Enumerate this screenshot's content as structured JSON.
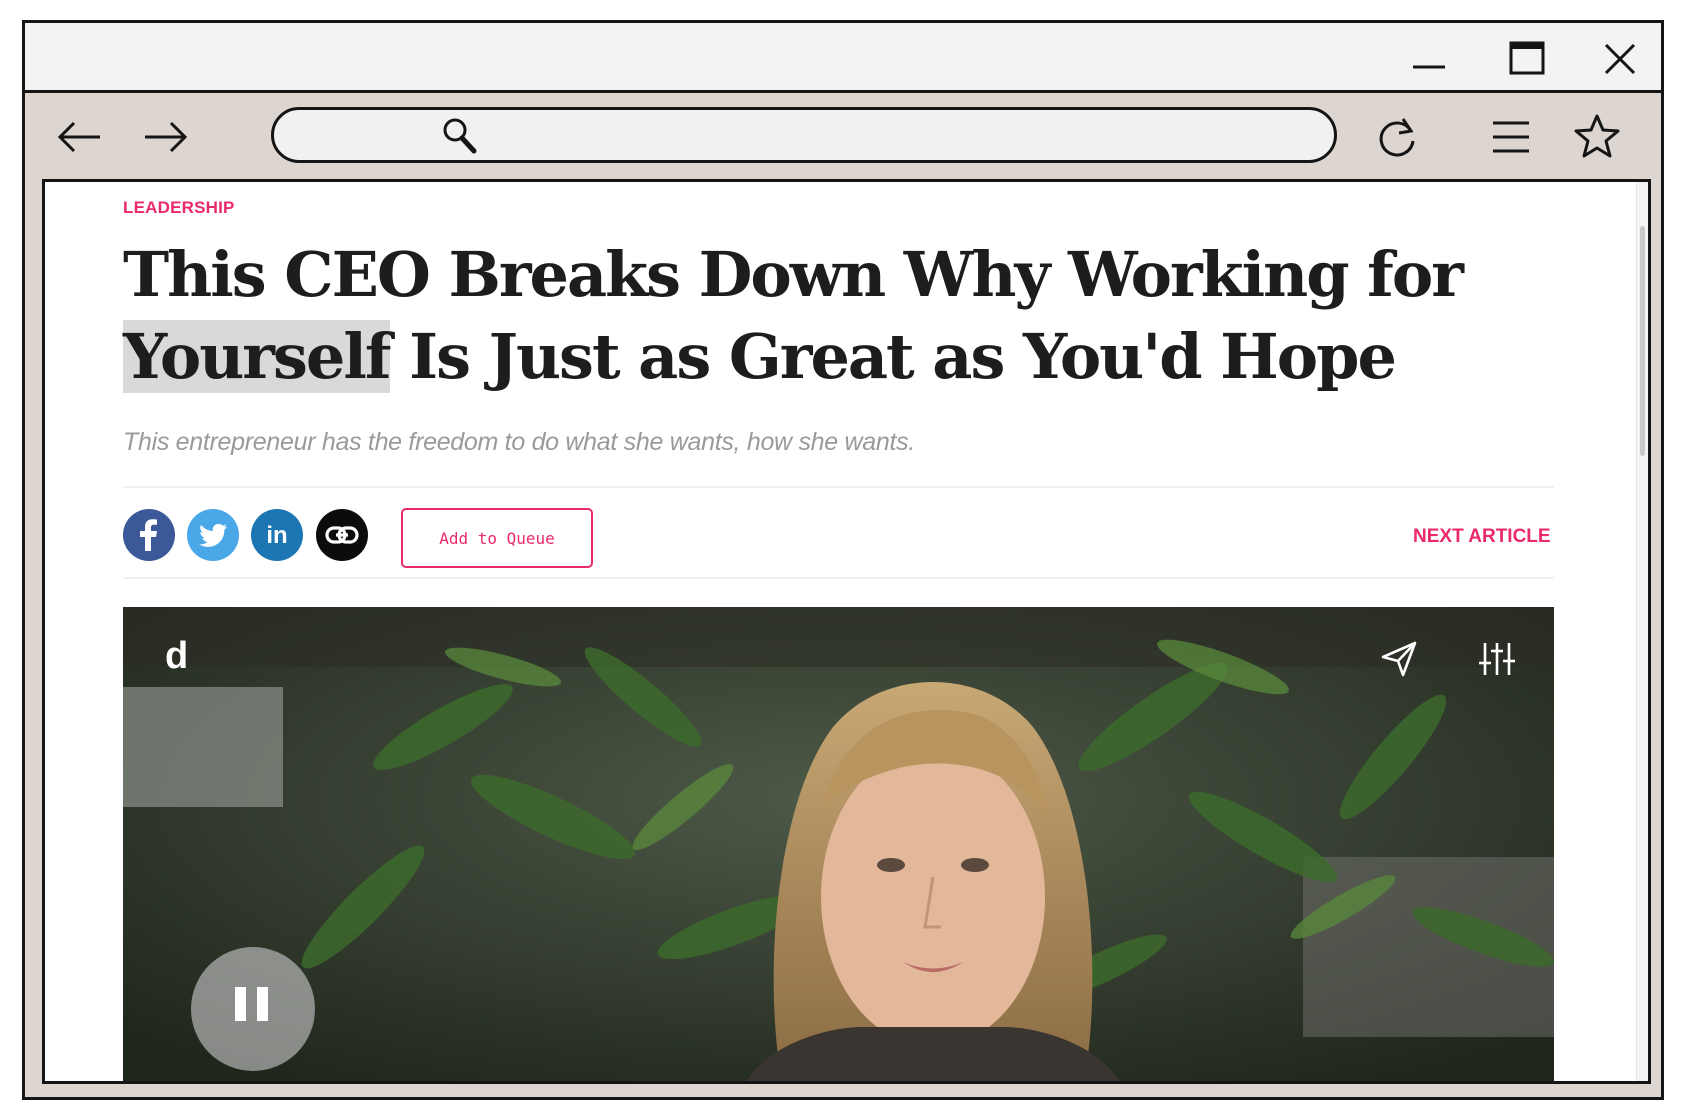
{
  "window": {
    "controls": [
      "minimize-icon",
      "maximize-icon",
      "close-icon"
    ]
  },
  "toolbar": {
    "icons": [
      "arrow-left-icon",
      "arrow-right-icon",
      "search-icon",
      "reload-icon",
      "menu-icon",
      "star-icon"
    ],
    "address_value": ""
  },
  "article": {
    "category": "LEADERSHIP",
    "headline_highlight": "Yourself",
    "headline_pre": "This CEO Breaks Down Why Working for ",
    "headline_post": " Is Just as Great as You'd Hope",
    "dek": "This entrepreneur has the freedom to do what she wants, how she wants.",
    "queue_label": "Add to Queue",
    "next_label": "NEXT ARTICLE"
  },
  "share": {
    "icons": [
      "facebook-icon",
      "twitter-icon",
      "linkedin-icon",
      "link-icon"
    ],
    "linkedin_text": "in"
  },
  "video": {
    "logo": "d",
    "controls": [
      "send-icon",
      "sliders-icon",
      "pause-icon"
    ]
  },
  "colors": {
    "accent": "#ea2a6a",
    "facebook": "#3b5998",
    "twitter": "#4aa8e8",
    "linkedin": "#1b76b3",
    "link": "#0c0c0c"
  }
}
